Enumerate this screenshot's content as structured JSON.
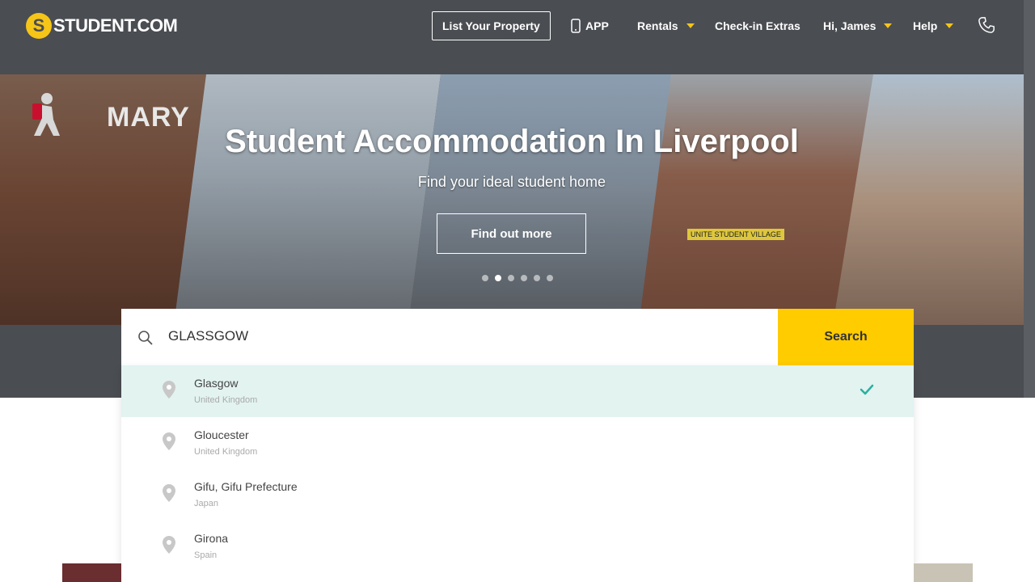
{
  "header": {
    "logo_text": "STUDENT.COM",
    "nav": {
      "list_property": "List Your Property",
      "app": "APP",
      "rentals": "Rentals",
      "checkin_extras": "Check-in Extras",
      "user": "Hi, James",
      "help": "Help"
    }
  },
  "hero": {
    "title": "Student Accommodation In Liverpool",
    "subtitle": "Find your ideal student home",
    "cta": "Find out more",
    "sign_mary": "MARY",
    "sign_village": "UNITE STUDENT VILLAGE",
    "slides_count": 6,
    "active_slide": 2
  },
  "search": {
    "value": "GLASSGOW",
    "button_label": "Search"
  },
  "suggestions": [
    {
      "name": "Glasgow",
      "country": "United Kingdom",
      "selected": true
    },
    {
      "name": "Gloucester",
      "country": "United Kingdom",
      "selected": false
    },
    {
      "name": "Gifu, Gifu Prefecture",
      "country": "Japan",
      "selected": false
    },
    {
      "name": "Girona",
      "country": "Spain",
      "selected": false
    }
  ],
  "colors": {
    "brand_yellow": "#ffcc00",
    "header_bg": "#4a4d52",
    "selected_row": "#e2f3f0",
    "check_teal": "#2ab0a0"
  }
}
